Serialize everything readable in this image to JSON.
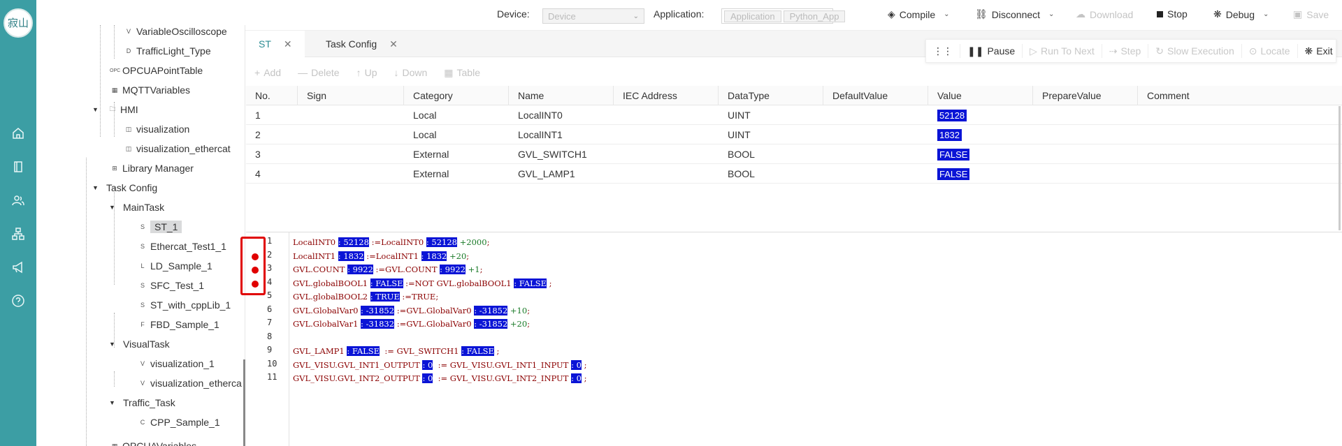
{
  "logo": {
    "text": "寂山"
  },
  "toolbar": {
    "device_label": "Device:",
    "device_value": "Device",
    "application_label": "Application:",
    "application_value": "Application",
    "application_value2": "Python_App",
    "compile": "Compile",
    "disconnect": "Disconnect",
    "download": "Download",
    "stop": "Stop",
    "debug": "Debug",
    "save": "Save"
  },
  "tree": {
    "items": [
      {
        "label": "VariableOscilloscope",
        "prefix": "V"
      },
      {
        "label": "TrafficLight_Type",
        "prefix": "D"
      },
      {
        "label": "OPCUAPointTable",
        "prefix": "OPC"
      },
      {
        "label": "MQTTVariables"
      },
      {
        "label": "HMI"
      },
      {
        "label": "visualization"
      },
      {
        "label": "visualization_ethercat"
      },
      {
        "label": "Library Manager"
      },
      {
        "label": "Task Config"
      },
      {
        "label": "MainTask"
      },
      {
        "label": "ST_1",
        "prefix": "S"
      },
      {
        "label": "Ethercat_Test1_1",
        "prefix": "S"
      },
      {
        "label": "LD_Sample_1",
        "prefix": "L"
      },
      {
        "label": "SFC_Test_1",
        "prefix": "S"
      },
      {
        "label": "ST_with_cppLib_1",
        "prefix": "S"
      },
      {
        "label": "FBD_Sample_1",
        "prefix": "F"
      },
      {
        "label": "VisualTask"
      },
      {
        "label": "visualization_1",
        "prefix": "V"
      },
      {
        "label": "visualization_etherca",
        "prefix": "V"
      },
      {
        "label": "Traffic_Task"
      },
      {
        "label": "CPP_Sample_1",
        "prefix": "C"
      },
      {
        "label": "OPCUAVariables"
      }
    ]
  },
  "tabs": [
    {
      "label": "ST"
    },
    {
      "label": "Task Config"
    }
  ],
  "debugbar": {
    "pause": "Pause",
    "run_to_next": "Run To Next",
    "step": "Step",
    "slow_execution": "Slow Execution",
    "locate": "Locate",
    "exit": "Exit"
  },
  "var_tools": {
    "add": "Add",
    "delete": "Delete",
    "up": "Up",
    "down": "Down",
    "table": "Table"
  },
  "var_table": {
    "headers": [
      "No.",
      "Sign",
      "Category",
      "Name",
      "IEC Address",
      "DataType",
      "DefaultValue",
      "Value",
      "PrepareValue",
      "Comment"
    ],
    "rows": [
      {
        "no": "1",
        "sign": "",
        "category": "Local",
        "name": "LocalINT0",
        "iec": "",
        "datatype": "UINT",
        "default": "",
        "value": "52128",
        "prepare": "",
        "comment": ""
      },
      {
        "no": "2",
        "sign": "",
        "category": "Local",
        "name": "LocalINT1",
        "iec": "",
        "datatype": "UINT",
        "default": "",
        "value": "1832",
        "prepare": "",
        "comment": ""
      },
      {
        "no": "3",
        "sign": "",
        "category": "External",
        "name": "GVL_SWITCH1",
        "iec": "",
        "datatype": "BOOL",
        "default": "",
        "value": "FALSE",
        "prepare": "",
        "comment": ""
      },
      {
        "no": "4",
        "sign": "",
        "category": "External",
        "name": "GVL_LAMP1",
        "iec": "",
        "datatype": "BOOL",
        "default": "",
        "value": "FALSE",
        "prepare": "",
        "comment": ""
      }
    ]
  },
  "code": {
    "line_numbers": [
      "1",
      "2",
      "3",
      "4",
      "5",
      "6",
      "7",
      "8",
      "9",
      "10",
      "11"
    ],
    "breakpoint_lines": [
      2,
      3,
      4
    ],
    "lines": [
      [
        {
          "t": "LocalINT0 "
        },
        {
          "v": ": 52128"
        },
        {
          "t": " :=LocalINT0 "
        },
        {
          "v": ": 52128"
        },
        {
          "n": " +2000"
        },
        {
          "t": ";"
        }
      ],
      [
        {
          "t": "LocalINT1 "
        },
        {
          "v": ": 1832"
        },
        {
          "t": " :=LocalINT1 "
        },
        {
          "v": ": 1832"
        },
        {
          "n": " +20"
        },
        {
          "t": ";"
        }
      ],
      [
        {
          "t": "GVL.COUNT "
        },
        {
          "v": ": 9922"
        },
        {
          "t": " :=GVL.COUNT "
        },
        {
          "v": ": 9922"
        },
        {
          "n": " +1"
        },
        {
          "t": ";"
        }
      ],
      [
        {
          "t": "GVL.globalBOOL1 "
        },
        {
          "v": ": FALSE"
        },
        {
          "t": " :=NOT GVL.globalBOOL1 "
        },
        {
          "v": ": FALSE"
        },
        {
          "t": " ;"
        }
      ],
      [
        {
          "t": "GVL.globalBOOL2 "
        },
        {
          "v": ": TRUE"
        },
        {
          "t": " :=TRUE;"
        }
      ],
      [
        {
          "t": "GVL.GlobalVar0 "
        },
        {
          "v": ": -31852"
        },
        {
          "t": " :=GVL.GlobalVar0 "
        },
        {
          "v": ": -31852"
        },
        {
          "n": " +10"
        },
        {
          "t": ";"
        }
      ],
      [
        {
          "t": "GVL.GlobalVar1 "
        },
        {
          "v": ": -31832"
        },
        {
          "t": " :=GVL.GlobalVar0 "
        },
        {
          "v": ": -31852"
        },
        {
          "n": " +20"
        },
        {
          "t": ";"
        }
      ],
      [],
      [
        {
          "t": "GVL_LAMP1 "
        },
        {
          "v": ": FALSE"
        },
        {
          "t": "  := GVL_SWITCH1 "
        },
        {
          "v": ": FALSE"
        },
        {
          "t": " ;"
        }
      ],
      [
        {
          "t": "GVL_VISU.GVL_INT1_OUTPUT "
        },
        {
          "v": ": 0"
        },
        {
          "t": "  := GVL_VISU.GVL_INT1_INPUT "
        },
        {
          "v": ": 0"
        },
        {
          "t": " ;"
        }
      ],
      [
        {
          "t": "GVL_VISU.GVL_INT2_OUTPUT "
        },
        {
          "v": ": 0"
        },
        {
          "t": "  := GVL_VISU.GVL_INT2_INPUT "
        },
        {
          "v": ": 0"
        },
        {
          "t": " ;"
        }
      ]
    ]
  },
  "colors": {
    "rail": "#3c9ea4",
    "value_highlight": "#0a14d6",
    "breakpoint": "#e00000",
    "active_tab": "#2c8c93"
  }
}
